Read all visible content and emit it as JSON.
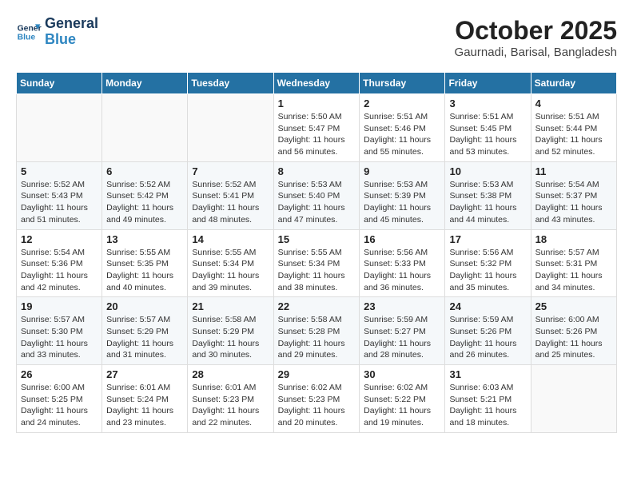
{
  "header": {
    "logo_line1": "General",
    "logo_line2": "Blue",
    "month": "October 2025",
    "location": "Gaurnadi, Barisal, Bangladesh"
  },
  "weekdays": [
    "Sunday",
    "Monday",
    "Tuesday",
    "Wednesday",
    "Thursday",
    "Friday",
    "Saturday"
  ],
  "weeks": [
    [
      {
        "day": "",
        "info": ""
      },
      {
        "day": "",
        "info": ""
      },
      {
        "day": "",
        "info": ""
      },
      {
        "day": "1",
        "info": "Sunrise: 5:50 AM\nSunset: 5:47 PM\nDaylight: 11 hours and 56 minutes."
      },
      {
        "day": "2",
        "info": "Sunrise: 5:51 AM\nSunset: 5:46 PM\nDaylight: 11 hours and 55 minutes."
      },
      {
        "day": "3",
        "info": "Sunrise: 5:51 AM\nSunset: 5:45 PM\nDaylight: 11 hours and 53 minutes."
      },
      {
        "day": "4",
        "info": "Sunrise: 5:51 AM\nSunset: 5:44 PM\nDaylight: 11 hours and 52 minutes."
      }
    ],
    [
      {
        "day": "5",
        "info": "Sunrise: 5:52 AM\nSunset: 5:43 PM\nDaylight: 11 hours and 51 minutes."
      },
      {
        "day": "6",
        "info": "Sunrise: 5:52 AM\nSunset: 5:42 PM\nDaylight: 11 hours and 49 minutes."
      },
      {
        "day": "7",
        "info": "Sunrise: 5:52 AM\nSunset: 5:41 PM\nDaylight: 11 hours and 48 minutes."
      },
      {
        "day": "8",
        "info": "Sunrise: 5:53 AM\nSunset: 5:40 PM\nDaylight: 11 hours and 47 minutes."
      },
      {
        "day": "9",
        "info": "Sunrise: 5:53 AM\nSunset: 5:39 PM\nDaylight: 11 hours and 45 minutes."
      },
      {
        "day": "10",
        "info": "Sunrise: 5:53 AM\nSunset: 5:38 PM\nDaylight: 11 hours and 44 minutes."
      },
      {
        "day": "11",
        "info": "Sunrise: 5:54 AM\nSunset: 5:37 PM\nDaylight: 11 hours and 43 minutes."
      }
    ],
    [
      {
        "day": "12",
        "info": "Sunrise: 5:54 AM\nSunset: 5:36 PM\nDaylight: 11 hours and 42 minutes."
      },
      {
        "day": "13",
        "info": "Sunrise: 5:55 AM\nSunset: 5:35 PM\nDaylight: 11 hours and 40 minutes."
      },
      {
        "day": "14",
        "info": "Sunrise: 5:55 AM\nSunset: 5:34 PM\nDaylight: 11 hours and 39 minutes."
      },
      {
        "day": "15",
        "info": "Sunrise: 5:55 AM\nSunset: 5:34 PM\nDaylight: 11 hours and 38 minutes."
      },
      {
        "day": "16",
        "info": "Sunrise: 5:56 AM\nSunset: 5:33 PM\nDaylight: 11 hours and 36 minutes."
      },
      {
        "day": "17",
        "info": "Sunrise: 5:56 AM\nSunset: 5:32 PM\nDaylight: 11 hours and 35 minutes."
      },
      {
        "day": "18",
        "info": "Sunrise: 5:57 AM\nSunset: 5:31 PM\nDaylight: 11 hours and 34 minutes."
      }
    ],
    [
      {
        "day": "19",
        "info": "Sunrise: 5:57 AM\nSunset: 5:30 PM\nDaylight: 11 hours and 33 minutes."
      },
      {
        "day": "20",
        "info": "Sunrise: 5:57 AM\nSunset: 5:29 PM\nDaylight: 11 hours and 31 minutes."
      },
      {
        "day": "21",
        "info": "Sunrise: 5:58 AM\nSunset: 5:29 PM\nDaylight: 11 hours and 30 minutes."
      },
      {
        "day": "22",
        "info": "Sunrise: 5:58 AM\nSunset: 5:28 PM\nDaylight: 11 hours and 29 minutes."
      },
      {
        "day": "23",
        "info": "Sunrise: 5:59 AM\nSunset: 5:27 PM\nDaylight: 11 hours and 28 minutes."
      },
      {
        "day": "24",
        "info": "Sunrise: 5:59 AM\nSunset: 5:26 PM\nDaylight: 11 hours and 26 minutes."
      },
      {
        "day": "25",
        "info": "Sunrise: 6:00 AM\nSunset: 5:26 PM\nDaylight: 11 hours and 25 minutes."
      }
    ],
    [
      {
        "day": "26",
        "info": "Sunrise: 6:00 AM\nSunset: 5:25 PM\nDaylight: 11 hours and 24 minutes."
      },
      {
        "day": "27",
        "info": "Sunrise: 6:01 AM\nSunset: 5:24 PM\nDaylight: 11 hours and 23 minutes."
      },
      {
        "day": "28",
        "info": "Sunrise: 6:01 AM\nSunset: 5:23 PM\nDaylight: 11 hours and 22 minutes."
      },
      {
        "day": "29",
        "info": "Sunrise: 6:02 AM\nSunset: 5:23 PM\nDaylight: 11 hours and 20 minutes."
      },
      {
        "day": "30",
        "info": "Sunrise: 6:02 AM\nSunset: 5:22 PM\nDaylight: 11 hours and 19 minutes."
      },
      {
        "day": "31",
        "info": "Sunrise: 6:03 AM\nSunset: 5:21 PM\nDaylight: 11 hours and 18 minutes."
      },
      {
        "day": "",
        "info": ""
      }
    ]
  ]
}
